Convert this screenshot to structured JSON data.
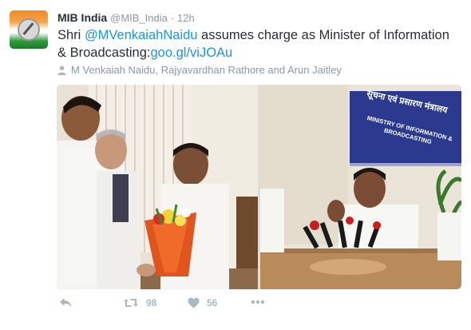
{
  "tweet": {
    "name": "MIB India",
    "handle": "@MIB_India",
    "separator": "·",
    "time": "12h",
    "text_prefix": "Shri ",
    "mention": "@MVenkaiahNaidu",
    "text_body": " assumes charge as Minister of Information & Broadcasting:",
    "link": "goo.gl/viJOAu",
    "tagged": "M Venkaiah Naidu, Rajyavardhan Rathore and Arun Jaitley"
  },
  "media": {
    "banner_text": "सूचना एवं प्रसारण मंत्रालय",
    "banner_text_en": "MINISTRY OF INFORMATION & BROADCASTING"
  },
  "actions": {
    "retweet_count": "98",
    "like_count": "56"
  },
  "icons": [
    "avatar-logo-icon",
    "person-icon",
    "reply-icon",
    "retweet-icon",
    "heart-icon",
    "more-icon"
  ],
  "colors": {
    "link": "#1b95e0",
    "muted": "#8899a6",
    "action": "#aab8c2",
    "banner": "#2b3a8f"
  }
}
